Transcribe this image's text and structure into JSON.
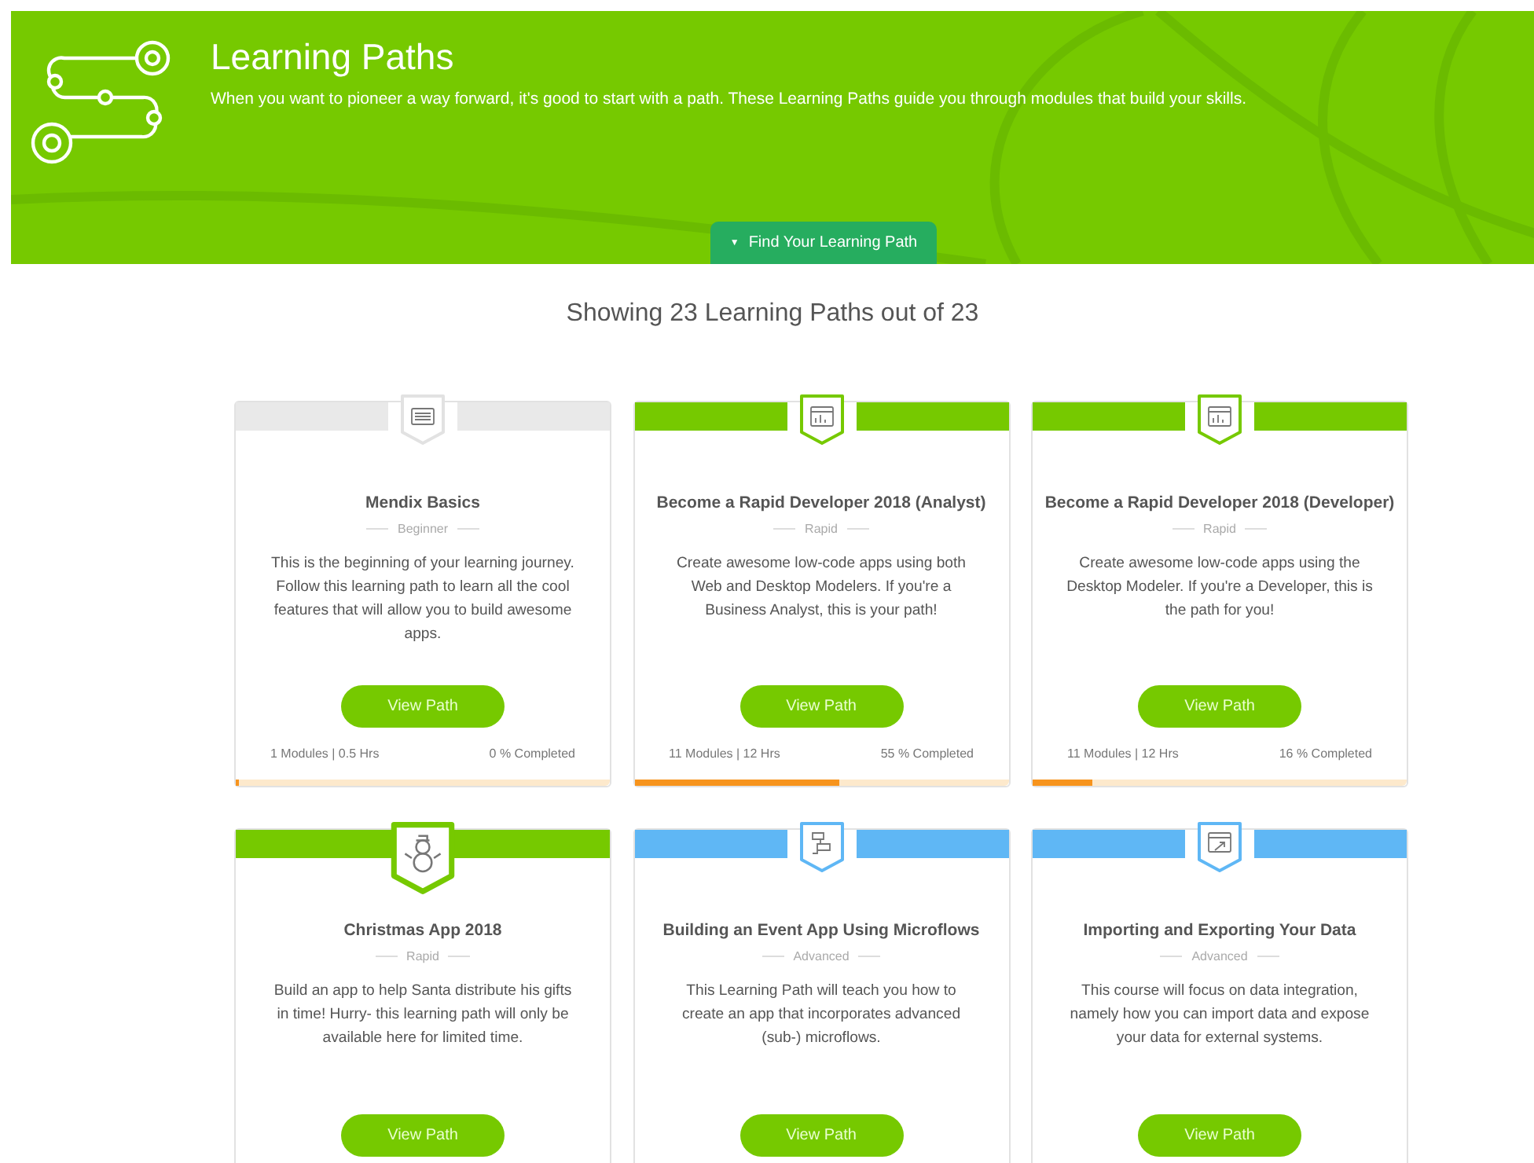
{
  "banner": {
    "title": "Learning Paths",
    "subtitle": "When you want to pioneer a way forward, it's good to start with a path. These Learning Paths guide you through modules that build your skills.",
    "filter_button": {
      "caret": "▼",
      "label": "Find Your Learning Path",
      "expanded": false
    }
  },
  "summary": "Showing 23 Learning Paths out of 23",
  "cards": [
    {
      "title": "Mendix Basics",
      "level_label": "Beginner",
      "description": "This is the beginning of your learning journey. Follow this learning path to learn all the cool features that will allow you to build awesome apps.",
      "button": "View Path",
      "modules": "1 Modules | 0.5 Hrs",
      "completed": "0 % Completed",
      "level": 0,
      "color": "#e9e9e9",
      "featured": false
    },
    {
      "title": "Become a Rapid Developer 2018 (Analyst)",
      "level_label": "Rapid",
      "description": "Create awesome low-code apps using both Web and Desktop Modelers. If you're a Business Analyst, this is your path!",
      "button": "View Path",
      "modules": "11 Modules | 12 Hrs",
      "completed": "55 % Completed",
      "level": 0.55,
      "color": "#76c900",
      "featured": false
    },
    {
      "title": "Become a Rapid Developer 2018 (Developer)",
      "level_label": "Rapid",
      "description": "Create awesome low-code apps using the Desktop Modeler. If you're a Developer, this is the path for you!",
      "button": "View Path",
      "modules": "11 Modules | 12 Hrs",
      "completed": "16 % Completed",
      "level": 0.16,
      "color": "#76c900",
      "featured": false
    },
    {
      "title": "Christmas App 2018",
      "level_label": "Rapid",
      "description": "Build an app to help Santa distribute his gifts in time! Hurry- this learning path will only be available here for limited time.",
      "button": "View Path",
      "color": "#76c900",
      "featured": true
    },
    {
      "title": "Building an Event App Using Microflows",
      "level_label": "Advanced",
      "description": "This Learning Path will teach you how to create an app that incorporates advanced (sub-) microflows.",
      "button": "View Path",
      "color": "#5fb7f5",
      "featured": false
    },
    {
      "title": "Importing and Exporting Your Data",
      "level_label": "Advanced",
      "description": "This course will focus on data integration, namely how you can import data and expose your data for external systems.",
      "button": "View Path",
      "color": "#5fb7f5",
      "featured": false
    }
  ]
}
